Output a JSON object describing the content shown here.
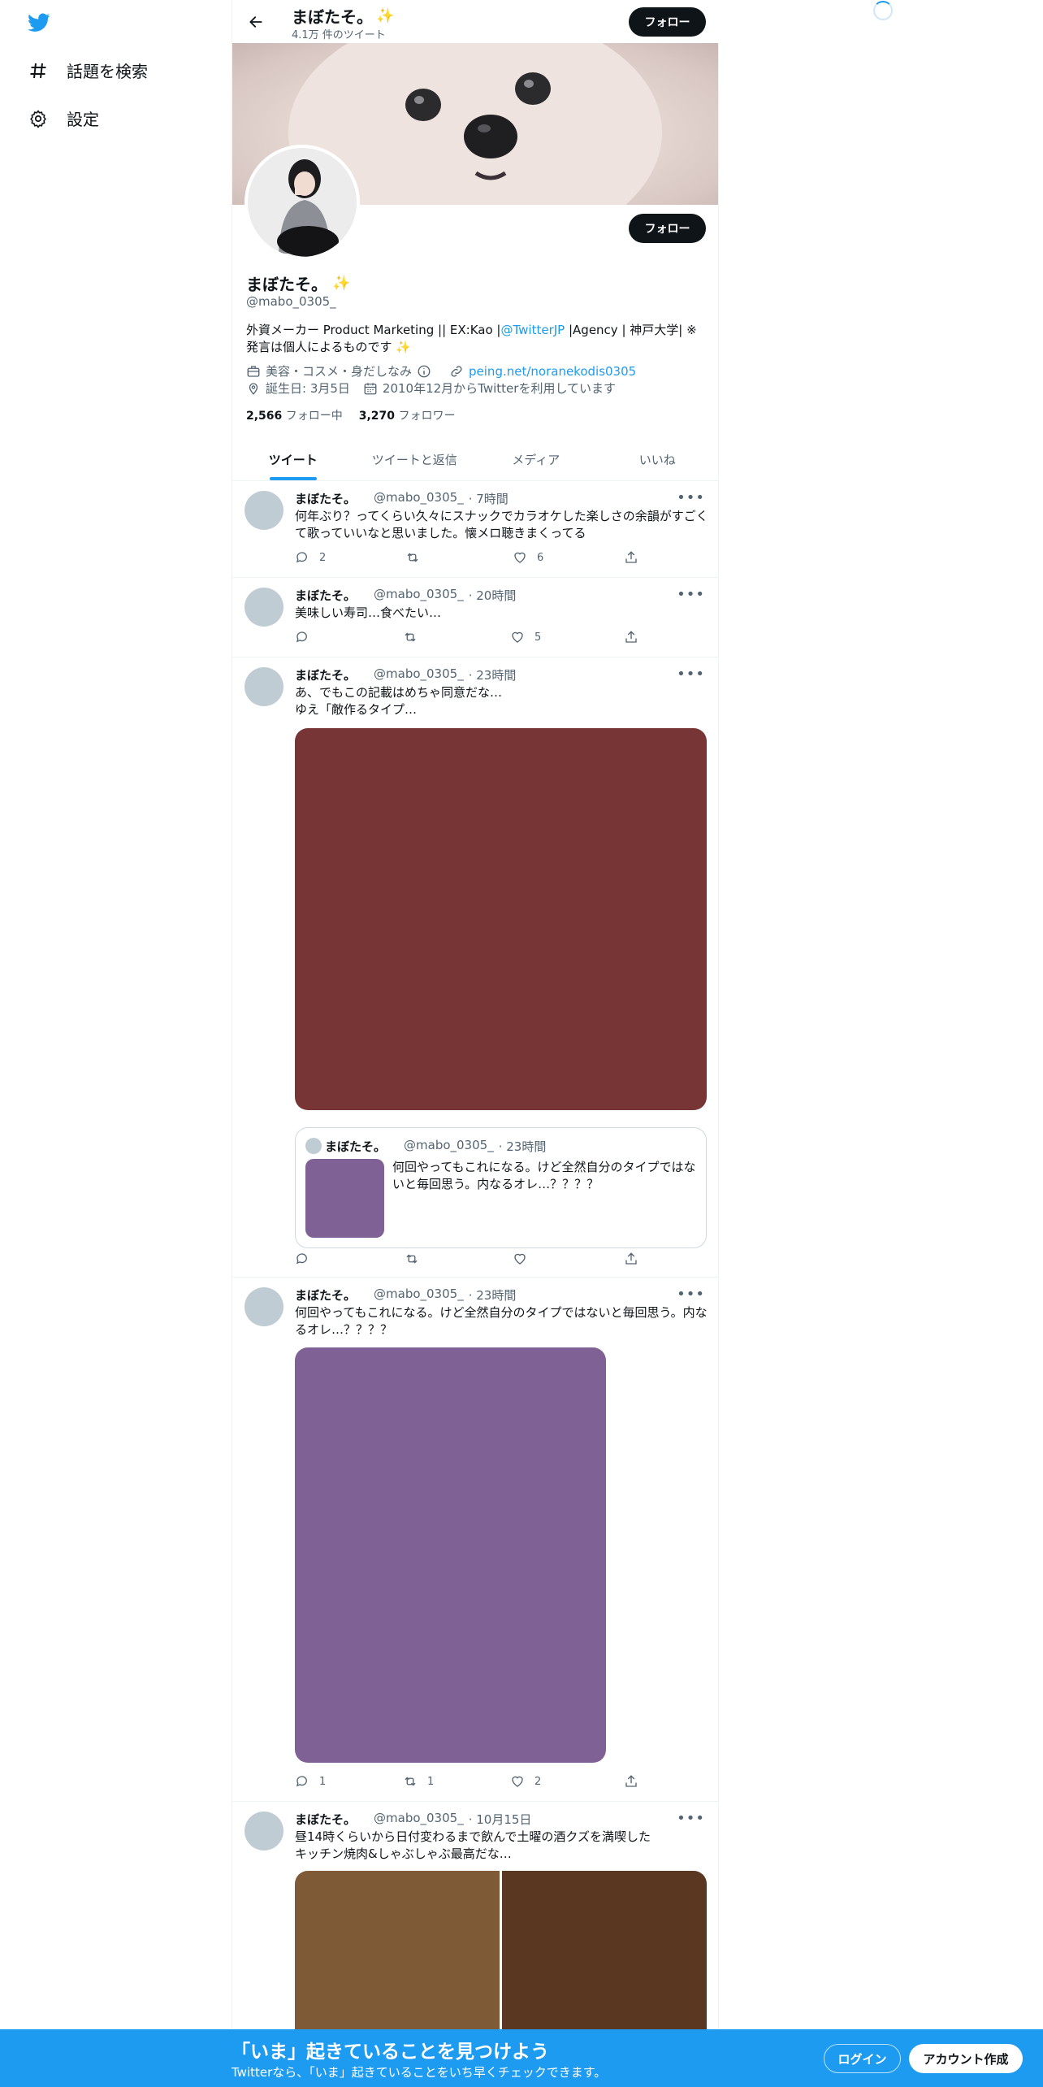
{
  "nav": {
    "explore_label": "話題を検索",
    "settings_label": "設定"
  },
  "header": {
    "name": "まぼたそ。",
    "tweet_count": "4.1万 件のツイート",
    "follow_label": "フォロー"
  },
  "profile": {
    "name": "まぼたそ。",
    "handle": "@mabo_0305_",
    "follow_label": "フォロー",
    "bio_part1": "外資メーカー Product Marketing || EX:Kao |",
    "bio_link": "@TwitterJP",
    "bio_part2": " |Agency | 神戸大学| ※発言は個人によるものです",
    "category": "美容・コスメ・身だしなみ",
    "website": "peing.net/noranekodis0305",
    "birthday": "誕生日: 3月5日",
    "joined": "2010年12月からTwitterを利用しています",
    "following_count": "2,566",
    "following_label": "フォロー中",
    "followers_count": "3,270",
    "followers_label": "フォロワー"
  },
  "tabs": [
    {
      "label": "ツイート"
    },
    {
      "label": "ツイートと返信"
    },
    {
      "label": "メディア"
    },
    {
      "label": "いいね"
    }
  ],
  "tweets": [
    {
      "name": "まぼたそ。",
      "handle": "@mabo_0305_",
      "time": "· 7時間",
      "text": "何年ぶり？ってくらい久々にスナックでカラオケした楽しさの余韻がすごくて歌っていいなと思いました。懐メロ聴きまくってる",
      "replies": "2",
      "retweets": "",
      "likes": "6"
    },
    {
      "name": "まぼたそ。",
      "handle": "@mabo_0305_",
      "time": "· 20時間",
      "text": "美味しい寿司…食べたい…",
      "replies": "",
      "retweets": "",
      "likes": "5"
    },
    {
      "name": "まぼたそ。",
      "handle": "@mabo_0305_",
      "time": "· 23時間",
      "text_line1": "あ、でもこの記載はめちゃ同意だな…",
      "text_line2": "ゆえ「敵作るタイプ…",
      "media_color": "#773536",
      "quote": {
        "name": "まぼたそ。",
        "handle": "@mabo_0305_",
        "time": "· 23時間",
        "text": "何回やってもこれになる。けど全然自分のタイプではないと毎回思う。内なるオレ…？？？？",
        "media_color": "#806195"
      },
      "replies": "",
      "retweets": "",
      "likes": ""
    },
    {
      "name": "まぼたそ。",
      "handle": "@mabo_0305_",
      "time": "· 23時間",
      "text": "何回やってもこれになる。けど全然自分のタイプではないと毎回思う。内なるオレ…？？？？",
      "media_color": "#806195",
      "replies": "1",
      "retweets": "1",
      "likes": "2"
    },
    {
      "name": "まぼたそ。",
      "handle": "@mabo_0305_",
      "time": "· 10月15日",
      "text_line1": "昼14時くらいから日付変わるまで飲んで土曜の酒クズを満喫した",
      "text_line2": "キッチン焼肉&しゃぶしゃぶ最高だな…",
      "media_colors": [
        "#7f5a36",
        "#5a3721"
      ]
    }
  ],
  "bottom_bar": {
    "title": "「いま」起きていることを見つけよう",
    "subtitle": "Twitterなら、「いま」起きていることをいち早くチェックできます。",
    "login_label": "ログイン",
    "signup_label": "アカウント作成"
  }
}
